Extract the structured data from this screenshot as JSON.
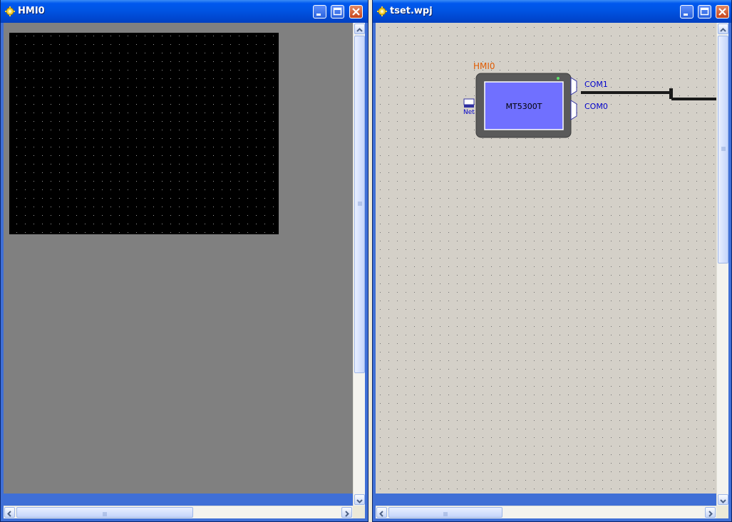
{
  "windows": {
    "hmi": {
      "title": "HMI0"
    },
    "project": {
      "title": "tset.wpj"
    }
  },
  "diagram": {
    "device_name_label": "HMI0",
    "device_model": "MT5300T",
    "port_com1": "COM1",
    "port_com0": "COM0",
    "port_net": "Net"
  },
  "colors": {
    "title_bar": "#0054e3",
    "hmi_screen": "#000000",
    "hmi_background": "#808080",
    "canvas_background": "#d4d0c8",
    "device_body": "#5a5a5a",
    "device_screen": "#7070ff",
    "device_label": "#e05a00",
    "port_label": "#0000cc"
  },
  "icons": {
    "window_icon": "gear-icon",
    "minimize": "minimize-icon",
    "maximize": "maximize-icon",
    "close": "close-icon",
    "scroll_up": "chevron-up-icon",
    "scroll_down": "chevron-down-icon",
    "scroll_left": "chevron-left-icon",
    "scroll_right": "chevron-right-icon"
  }
}
